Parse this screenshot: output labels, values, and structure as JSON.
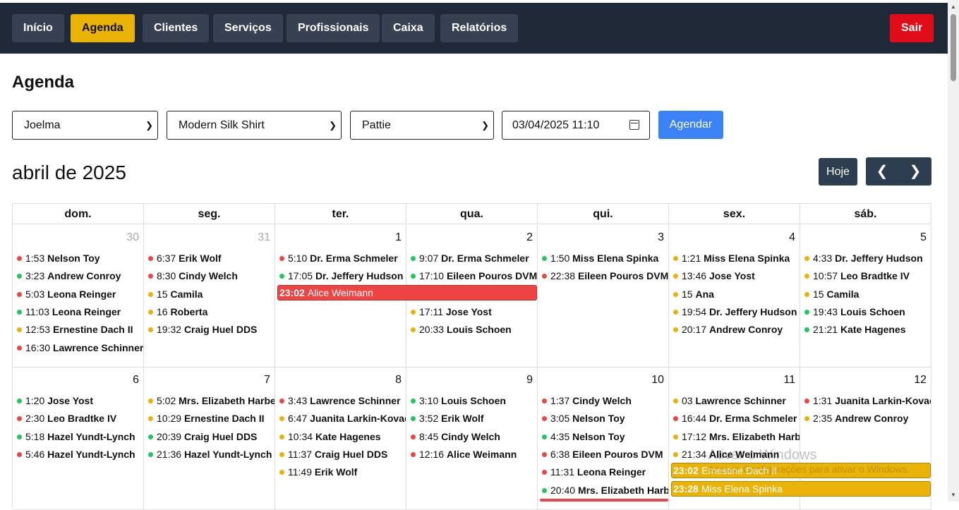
{
  "nav": {
    "items": [
      "Início",
      "Agenda",
      "Clientes",
      "Serviços",
      "Profissionais",
      "Caixa",
      "Relatórios"
    ],
    "active": "Agenda",
    "logout": "Sair"
  },
  "page": {
    "title": "Agenda"
  },
  "form": {
    "client_select": "Joelma",
    "service_select": "Modern Silk Shirt",
    "professional_select": "Pattie",
    "datetime": "03/04/2025 11:10",
    "submit_label": "Agendar"
  },
  "calendar": {
    "title": "abril de 2025",
    "today_label": "Hoje",
    "prev_icon": "chevron-left-icon",
    "next_icon": "chevron-right-icon",
    "weekdays": [
      "dom.",
      "seg.",
      "ter.",
      "qua.",
      "qui.",
      "sex.",
      "sáb."
    ],
    "colors": {
      "red": "#ef4444",
      "green": "#22c55e",
      "yellow": "#eab308"
    },
    "weeks": [
      {
        "days": [
          {
            "num": "30",
            "other": true,
            "events": [
              {
                "t": "1:53",
                "n": "Nelson Toy",
                "c": "red"
              },
              {
                "t": "3:23",
                "n": "Andrew Conroy",
                "c": "green"
              },
              {
                "t": "5:03",
                "n": "Leona Reinger",
                "c": "red"
              },
              {
                "t": "11:03",
                "n": "Leona Reinger",
                "c": "green"
              },
              {
                "t": "12:53",
                "n": "Ernestine Dach II",
                "c": "yellow"
              },
              {
                "t": "16:30",
                "n": "Lawrence Schinner",
                "c": "red"
              }
            ]
          },
          {
            "num": "31",
            "other": true,
            "events": [
              {
                "t": "6:37",
                "n": "Erik Wolf",
                "c": "red"
              },
              {
                "t": "8:30",
                "n": "Cindy Welch",
                "c": "red"
              },
              {
                "t": "15",
                "n": "Camila",
                "c": "yellow"
              },
              {
                "t": "16",
                "n": "Roberta",
                "c": "yellow"
              },
              {
                "t": "19:32",
                "n": "Craig Huel DDS",
                "c": "yellow"
              }
            ]
          },
          {
            "num": "1",
            "events": [
              {
                "t": "5:10",
                "n": "Dr. Erma Schmeler",
                "c": "red"
              },
              {
                "t": "17:05",
                "n": "Dr. Jeffery Hudson",
                "c": "green"
              }
            ]
          },
          {
            "num": "2",
            "events": [
              {
                "t": "9:07",
                "n": "Dr. Erma Schmeler",
                "c": "green"
              },
              {
                "t": "17:10",
                "n": "Eileen Pouros DVM",
                "c": "green"
              },
              {
                "t": "17:11",
                "n": "Jose Yost",
                "c": "yellow",
                "slot": 3
              },
              {
                "t": "20:33",
                "n": "Louis Schoen",
                "c": "yellow",
                "slot": 4
              }
            ]
          },
          {
            "num": "3",
            "events": [
              {
                "t": "1:50",
                "n": "Miss Elena Spinka",
                "c": "green"
              },
              {
                "t": "22:38",
                "n": "Eileen Pouros DVM",
                "c": "red"
              }
            ]
          },
          {
            "num": "4",
            "events": [
              {
                "t": "1:21",
                "n": "Miss Elena Spinka",
                "c": "yellow"
              },
              {
                "t": "13:46",
                "n": "Jose Yost",
                "c": "yellow"
              },
              {
                "t": "15",
                "n": "Ana",
                "c": "yellow"
              },
              {
                "t": "19:54",
                "n": "Dr. Jeffery Hudson",
                "c": "yellow"
              },
              {
                "t": "20:17",
                "n": "Andrew Conroy",
                "c": "yellow"
              }
            ]
          },
          {
            "num": "5",
            "events": [
              {
                "t": "4:33",
                "n": "Dr. Jeffery Hudson",
                "c": "yellow"
              },
              {
                "t": "10:57",
                "n": "Leo Bradtke IV",
                "c": "yellow"
              },
              {
                "t": "15",
                "n": "Camila",
                "c": "yellow"
              },
              {
                "t": "19:43",
                "n": "Louis Schoen",
                "c": "green"
              },
              {
                "t": "21:21",
                "n": "Kate Hagenes",
                "c": "green"
              }
            ]
          }
        ],
        "bars": [
          {
            "t": "23:02",
            "n": "Alice Weimann",
            "c": "red",
            "start": 2,
            "span": 2,
            "slot": 2
          }
        ]
      },
      {
        "days": [
          {
            "num": "6",
            "events": [
              {
                "t": "1:20",
                "n": "Jose Yost",
                "c": "green"
              },
              {
                "t": "2:30",
                "n": "Leo Bradtke IV",
                "c": "red"
              },
              {
                "t": "5:18",
                "n": "Hazel Yundt-Lynch",
                "c": "green"
              },
              {
                "t": "5:46",
                "n": "Hazel Yundt-Lynch",
                "c": "red"
              }
            ]
          },
          {
            "num": "7",
            "events": [
              {
                "t": "5:02",
                "n": "Mrs. Elizabeth Harber",
                "c": "yellow"
              },
              {
                "t": "10:29",
                "n": "Ernestine Dach II",
                "c": "yellow"
              },
              {
                "t": "20:39",
                "n": "Craig Huel DDS",
                "c": "green"
              },
              {
                "t": "21:36",
                "n": "Hazel Yundt-Lynch",
                "c": "green"
              }
            ]
          },
          {
            "num": "8",
            "events": [
              {
                "t": "3:43",
                "n": "Lawrence Schinner",
                "c": "red"
              },
              {
                "t": "6:47",
                "n": "Juanita Larkin-Kovacek",
                "c": "yellow"
              },
              {
                "t": "10:34",
                "n": "Kate Hagenes",
                "c": "yellow"
              },
              {
                "t": "11:37",
                "n": "Craig Huel DDS",
                "c": "yellow"
              },
              {
                "t": "11:49",
                "n": "Erik Wolf",
                "c": "yellow"
              }
            ]
          },
          {
            "num": "9",
            "events": [
              {
                "t": "3:10",
                "n": "Louis Schoen",
                "c": "green"
              },
              {
                "t": "3:52",
                "n": "Erik Wolf",
                "c": "green"
              },
              {
                "t": "8:45",
                "n": "Cindy Welch",
                "c": "red"
              },
              {
                "t": "12:16",
                "n": "Alice Weimann",
                "c": "red"
              }
            ]
          },
          {
            "num": "10",
            "events": [
              {
                "t": "1:37",
                "n": "Cindy Welch",
                "c": "red"
              },
              {
                "t": "3:05",
                "n": "Nelson Toy",
                "c": "red"
              },
              {
                "t": "4:35",
                "n": "Nelson Toy",
                "c": "green"
              },
              {
                "t": "6:38",
                "n": "Eileen Pouros DVM",
                "c": "red"
              },
              {
                "t": "11:31",
                "n": "Leona Reinger",
                "c": "red"
              },
              {
                "t": "20:40",
                "n": "Mrs. Elizabeth Harber",
                "c": "green"
              }
            ]
          },
          {
            "num": "11",
            "events": [
              {
                "t": "03",
                "n": "Lawrence Schinner",
                "c": "yellow"
              },
              {
                "t": "16:44",
                "n": "Dr. Erma Schmeler",
                "c": "red"
              },
              {
                "t": "17:12",
                "n": "Mrs. Elizabeth Harber",
                "c": "yellow"
              },
              {
                "t": "21:34",
                "n": "Alice Weimann",
                "c": "yellow"
              }
            ]
          },
          {
            "num": "12",
            "events": [
              {
                "t": "1:31",
                "n": "Juanita Larkin-Kovacek",
                "c": "red"
              },
              {
                "t": "2:35",
                "n": "Andrew Conroy",
                "c": "yellow"
              }
            ]
          }
        ],
        "bars": [
          {
            "t": "23:02",
            "n": "Ernestine Dach II",
            "c": "yellow",
            "start": 5,
            "span": 2,
            "slot": 4
          },
          {
            "t": "23:28",
            "n": "Miss Elena Spinka",
            "c": "yellow",
            "start": 5,
            "span": 2,
            "slot": 5
          },
          {
            "t": "",
            "n": "",
            "c": "red",
            "start": 4,
            "span": 1,
            "slot": 6,
            "partial": true
          }
        ]
      }
    ]
  },
  "watermark": {
    "line1": "Ativar o Windows",
    "line2": "Acesse Configurações para ativar o Windows."
  }
}
